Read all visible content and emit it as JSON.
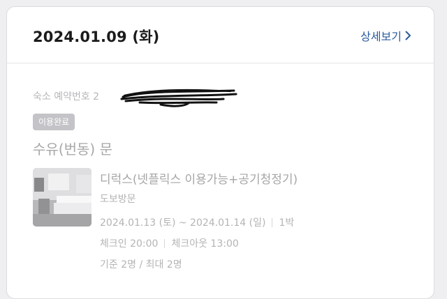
{
  "header": {
    "date": "2024.01.09 (화)",
    "detail_label": "상세보기",
    "detail_icon": "chevron-right-icon"
  },
  "reservation": {
    "label": "숙소 예약번호 2"
  },
  "status": "이용완료",
  "property": "수유(번동) 문",
  "room": {
    "name": "디럭스(넷플릭스 이용가능+공기청정기)",
    "type": "도보방문",
    "checkin_date": "2024.01.13 (토) ~ 2024.01.14 (일)",
    "nights": "1박",
    "checkin_time": "체크인 20:00",
    "checkout_time": "체크아웃 13:00",
    "guests": "기준 2명 / 최대 2명"
  },
  "colors": {
    "accent": "#2a5a9e",
    "badge": "#c4c4c8",
    "muted_text": "#b4b4b8"
  }
}
